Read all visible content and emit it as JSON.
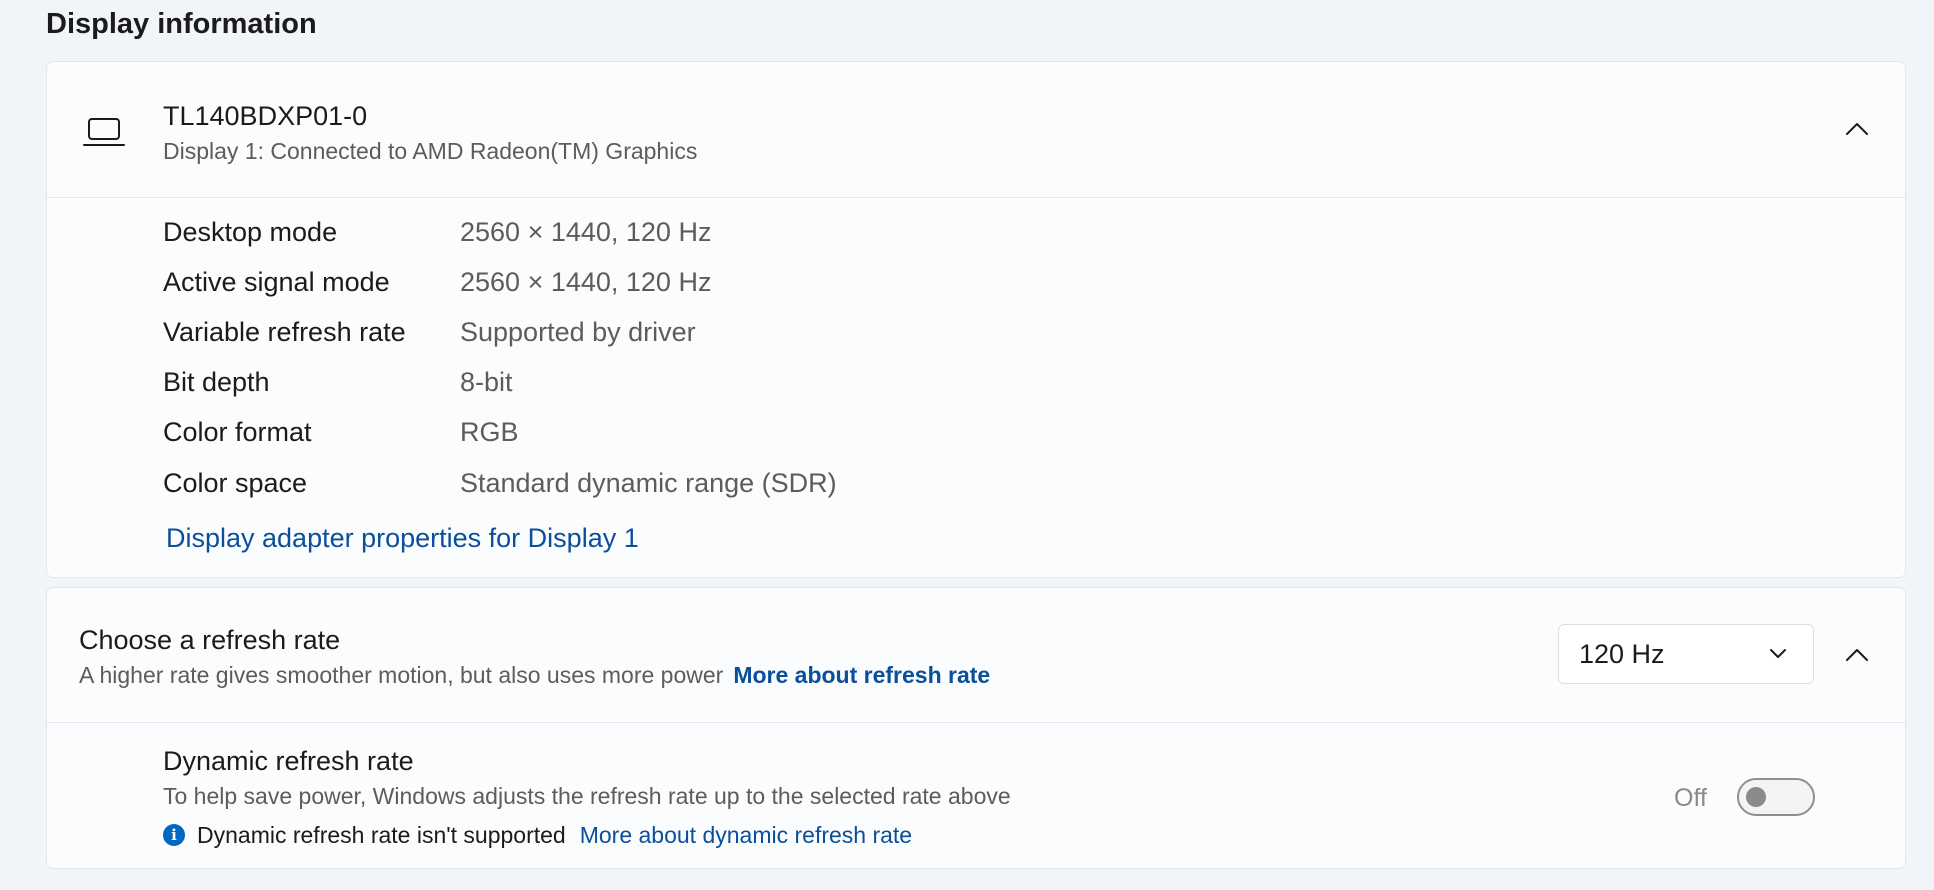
{
  "section": {
    "title": "Display information"
  },
  "monitor": {
    "name": "TL140BDXP01-0",
    "subtitle": "Display 1: Connected to AMD Radeon(TM) Graphics",
    "icon": "laptop-icon"
  },
  "details": [
    {
      "label": "Desktop mode",
      "value": "2560 × 1440, 120 Hz"
    },
    {
      "label": "Active signal mode",
      "value": "2560 × 1440, 120 Hz"
    },
    {
      "label": "Variable refresh rate",
      "value": "Supported by driver"
    },
    {
      "label": "Bit depth",
      "value": "8-bit"
    },
    {
      "label": "Color format",
      "value": "RGB"
    },
    {
      "label": "Color space",
      "value": "Standard dynamic range (SDR)"
    }
  ],
  "adapter_link": "Display adapter properties for Display 1",
  "refresh_rate": {
    "title": "Choose a refresh rate",
    "description": "A higher rate gives smoother motion, but also uses more power",
    "link": "More about refresh rate",
    "selected": "120 Hz"
  },
  "dynamic_refresh": {
    "title": "Dynamic refresh rate",
    "description": "To help save power, Windows adjusts the refresh rate up to the selected rate above",
    "note": "Dynamic refresh rate isn't supported",
    "link": "More about dynamic refresh rate",
    "toggle_label": "Off",
    "toggle_state": "off"
  },
  "colors": {
    "link": "#0a4f9c",
    "info_icon": "#0067c0",
    "background": "#f1f4f9",
    "card": "#fbfcfd"
  }
}
